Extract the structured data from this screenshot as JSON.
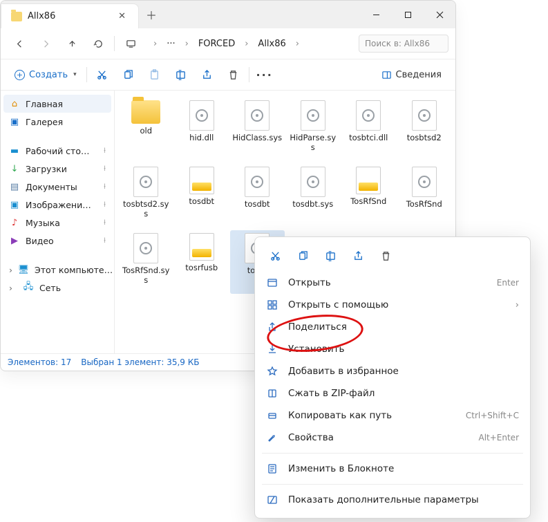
{
  "tab": {
    "title": "Allx86"
  },
  "breadcrumbs": {
    "dots": "···",
    "items": [
      "FORCED",
      "Allx86"
    ]
  },
  "search": {
    "placeholder": "Поиск в: Allx86"
  },
  "toolbar": {
    "create": "Создать",
    "details": "Сведения"
  },
  "sidebar": {
    "home": "Главная",
    "gallery": "Галерея",
    "quick": [
      "Рабочий сто…",
      "Загрузки",
      "Документы",
      "Изображени…",
      "Музыка",
      "Видео"
    ],
    "thispc": "Этот компьюте…",
    "network": "Сеть"
  },
  "files": [
    {
      "name": "old",
      "type": "folder"
    },
    {
      "name": "hid.dll",
      "type": "gear"
    },
    {
      "name": "HidClass.sys",
      "type": "gear"
    },
    {
      "name": "HidParse.sys",
      "type": "gear"
    },
    {
      "name": "tosbtci.dll",
      "type": "gear"
    },
    {
      "name": "tosbtsd2",
      "type": "geardoc"
    },
    {
      "name": "tosbtsd2.sys",
      "type": "gear"
    },
    {
      "name": "tosdbt",
      "type": "cab"
    },
    {
      "name": "tosdbt",
      "type": "geardoc"
    },
    {
      "name": "tosdbt.sys",
      "type": "gear"
    },
    {
      "name": "TosRfSnd",
      "type": "cab"
    },
    {
      "name": "TosRfSnd",
      "type": "geardoc"
    },
    {
      "name": "TosRfSnd.sys",
      "type": "gear"
    },
    {
      "name": "tosrfusb",
      "type": "cab"
    },
    {
      "name": "tos…",
      "type": "geardoc",
      "selected": true
    }
  ],
  "status": {
    "count": "Элементов: 17",
    "selection": "Выбран 1 элемент: 35,9 КБ"
  },
  "ctx": {
    "open": "Открыть",
    "open_kb": "Enter",
    "openwith": "Открыть с помощью",
    "share": "Поделиться",
    "install": "Установить",
    "fav": "Добавить в избранное",
    "zip": "Сжать в ZIP-файл",
    "copypath": "Копировать как путь",
    "copypath_kb": "Ctrl+Shift+C",
    "props": "Свойства",
    "props_kb": "Alt+Enter",
    "notepad": "Изменить в Блокноте",
    "more": "Показать дополнительные параметры"
  }
}
